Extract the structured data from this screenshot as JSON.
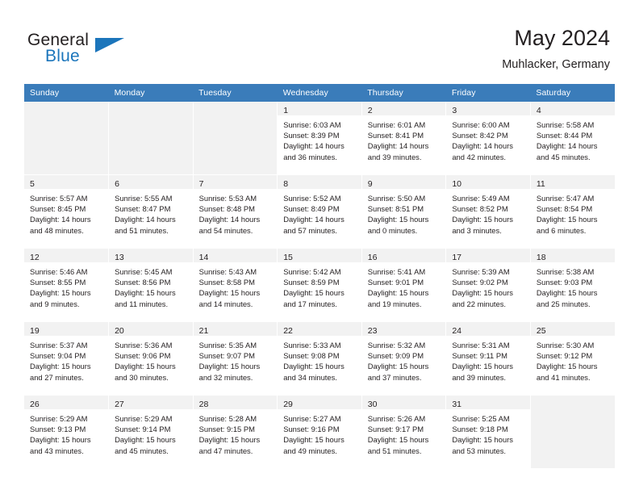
{
  "brand": {
    "word_one": "General",
    "word_two": "Blue",
    "logo_icon": "triangle-flag-icon"
  },
  "header": {
    "title": "May 2024",
    "location": "Muhlacker, Germany"
  },
  "calendar": {
    "weekday_headers": [
      "Sunday",
      "Monday",
      "Tuesday",
      "Wednesday",
      "Thursday",
      "Friday",
      "Saturday"
    ],
    "weeks": [
      [
        {
          "day": "",
          "empty": true
        },
        {
          "day": "",
          "empty": true
        },
        {
          "day": "",
          "empty": true
        },
        {
          "day": "1",
          "sunrise": "Sunrise: 6:03 AM",
          "sunset": "Sunset: 8:39 PM",
          "daylight_line1": "Daylight: 14 hours",
          "daylight_line2": "and 36 minutes."
        },
        {
          "day": "2",
          "sunrise": "Sunrise: 6:01 AM",
          "sunset": "Sunset: 8:41 PM",
          "daylight_line1": "Daylight: 14 hours",
          "daylight_line2": "and 39 minutes."
        },
        {
          "day": "3",
          "sunrise": "Sunrise: 6:00 AM",
          "sunset": "Sunset: 8:42 PM",
          "daylight_line1": "Daylight: 14 hours",
          "daylight_line2": "and 42 minutes."
        },
        {
          "day": "4",
          "sunrise": "Sunrise: 5:58 AM",
          "sunset": "Sunset: 8:44 PM",
          "daylight_line1": "Daylight: 14 hours",
          "daylight_line2": "and 45 minutes."
        }
      ],
      [
        {
          "day": "5",
          "sunrise": "Sunrise: 5:57 AM",
          "sunset": "Sunset: 8:45 PM",
          "daylight_line1": "Daylight: 14 hours",
          "daylight_line2": "and 48 minutes."
        },
        {
          "day": "6",
          "sunrise": "Sunrise: 5:55 AM",
          "sunset": "Sunset: 8:47 PM",
          "daylight_line1": "Daylight: 14 hours",
          "daylight_line2": "and 51 minutes."
        },
        {
          "day": "7",
          "sunrise": "Sunrise: 5:53 AM",
          "sunset": "Sunset: 8:48 PM",
          "daylight_line1": "Daylight: 14 hours",
          "daylight_line2": "and 54 minutes."
        },
        {
          "day": "8",
          "sunrise": "Sunrise: 5:52 AM",
          "sunset": "Sunset: 8:49 PM",
          "daylight_line1": "Daylight: 14 hours",
          "daylight_line2": "and 57 minutes."
        },
        {
          "day": "9",
          "sunrise": "Sunrise: 5:50 AM",
          "sunset": "Sunset: 8:51 PM",
          "daylight_line1": "Daylight: 15 hours",
          "daylight_line2": "and 0 minutes."
        },
        {
          "day": "10",
          "sunrise": "Sunrise: 5:49 AM",
          "sunset": "Sunset: 8:52 PM",
          "daylight_line1": "Daylight: 15 hours",
          "daylight_line2": "and 3 minutes."
        },
        {
          "day": "11",
          "sunrise": "Sunrise: 5:47 AM",
          "sunset": "Sunset: 8:54 PM",
          "daylight_line1": "Daylight: 15 hours",
          "daylight_line2": "and 6 minutes."
        }
      ],
      [
        {
          "day": "12",
          "sunrise": "Sunrise: 5:46 AM",
          "sunset": "Sunset: 8:55 PM",
          "daylight_line1": "Daylight: 15 hours",
          "daylight_line2": "and 9 minutes."
        },
        {
          "day": "13",
          "sunrise": "Sunrise: 5:45 AM",
          "sunset": "Sunset: 8:56 PM",
          "daylight_line1": "Daylight: 15 hours",
          "daylight_line2": "and 11 minutes."
        },
        {
          "day": "14",
          "sunrise": "Sunrise: 5:43 AM",
          "sunset": "Sunset: 8:58 PM",
          "daylight_line1": "Daylight: 15 hours",
          "daylight_line2": "and 14 minutes."
        },
        {
          "day": "15",
          "sunrise": "Sunrise: 5:42 AM",
          "sunset": "Sunset: 8:59 PM",
          "daylight_line1": "Daylight: 15 hours",
          "daylight_line2": "and 17 minutes."
        },
        {
          "day": "16",
          "sunrise": "Sunrise: 5:41 AM",
          "sunset": "Sunset: 9:01 PM",
          "daylight_line1": "Daylight: 15 hours",
          "daylight_line2": "and 19 minutes."
        },
        {
          "day": "17",
          "sunrise": "Sunrise: 5:39 AM",
          "sunset": "Sunset: 9:02 PM",
          "daylight_line1": "Daylight: 15 hours",
          "daylight_line2": "and 22 minutes."
        },
        {
          "day": "18",
          "sunrise": "Sunrise: 5:38 AM",
          "sunset": "Sunset: 9:03 PM",
          "daylight_line1": "Daylight: 15 hours",
          "daylight_line2": "and 25 minutes."
        }
      ],
      [
        {
          "day": "19",
          "sunrise": "Sunrise: 5:37 AM",
          "sunset": "Sunset: 9:04 PM",
          "daylight_line1": "Daylight: 15 hours",
          "daylight_line2": "and 27 minutes."
        },
        {
          "day": "20",
          "sunrise": "Sunrise: 5:36 AM",
          "sunset": "Sunset: 9:06 PM",
          "daylight_line1": "Daylight: 15 hours",
          "daylight_line2": "and 30 minutes."
        },
        {
          "day": "21",
          "sunrise": "Sunrise: 5:35 AM",
          "sunset": "Sunset: 9:07 PM",
          "daylight_line1": "Daylight: 15 hours",
          "daylight_line2": "and 32 minutes."
        },
        {
          "day": "22",
          "sunrise": "Sunrise: 5:33 AM",
          "sunset": "Sunset: 9:08 PM",
          "daylight_line1": "Daylight: 15 hours",
          "daylight_line2": "and 34 minutes."
        },
        {
          "day": "23",
          "sunrise": "Sunrise: 5:32 AM",
          "sunset": "Sunset: 9:09 PM",
          "daylight_line1": "Daylight: 15 hours",
          "daylight_line2": "and 37 minutes."
        },
        {
          "day": "24",
          "sunrise": "Sunrise: 5:31 AM",
          "sunset": "Sunset: 9:11 PM",
          "daylight_line1": "Daylight: 15 hours",
          "daylight_line2": "and 39 minutes."
        },
        {
          "day": "25",
          "sunrise": "Sunrise: 5:30 AM",
          "sunset": "Sunset: 9:12 PM",
          "daylight_line1": "Daylight: 15 hours",
          "daylight_line2": "and 41 minutes."
        }
      ],
      [
        {
          "day": "26",
          "sunrise": "Sunrise: 5:29 AM",
          "sunset": "Sunset: 9:13 PM",
          "daylight_line1": "Daylight: 15 hours",
          "daylight_line2": "and 43 minutes."
        },
        {
          "day": "27",
          "sunrise": "Sunrise: 5:29 AM",
          "sunset": "Sunset: 9:14 PM",
          "daylight_line1": "Daylight: 15 hours",
          "daylight_line2": "and 45 minutes."
        },
        {
          "day": "28",
          "sunrise": "Sunrise: 5:28 AM",
          "sunset": "Sunset: 9:15 PM",
          "daylight_line1": "Daylight: 15 hours",
          "daylight_line2": "and 47 minutes."
        },
        {
          "day": "29",
          "sunrise": "Sunrise: 5:27 AM",
          "sunset": "Sunset: 9:16 PM",
          "daylight_line1": "Daylight: 15 hours",
          "daylight_line2": "and 49 minutes."
        },
        {
          "day": "30",
          "sunrise": "Sunrise: 5:26 AM",
          "sunset": "Sunset: 9:17 PM",
          "daylight_line1": "Daylight: 15 hours",
          "daylight_line2": "and 51 minutes."
        },
        {
          "day": "31",
          "sunrise": "Sunrise: 5:25 AM",
          "sunset": "Sunset: 9:18 PM",
          "daylight_line1": "Daylight: 15 hours",
          "daylight_line2": "and 53 minutes."
        },
        {
          "day": "",
          "empty": true
        }
      ]
    ]
  },
  "colors": {
    "header_blue": "#3a7cba",
    "brand_blue": "#1b75bb",
    "cell_shade": "#f2f2f2",
    "text": "#231f20"
  }
}
